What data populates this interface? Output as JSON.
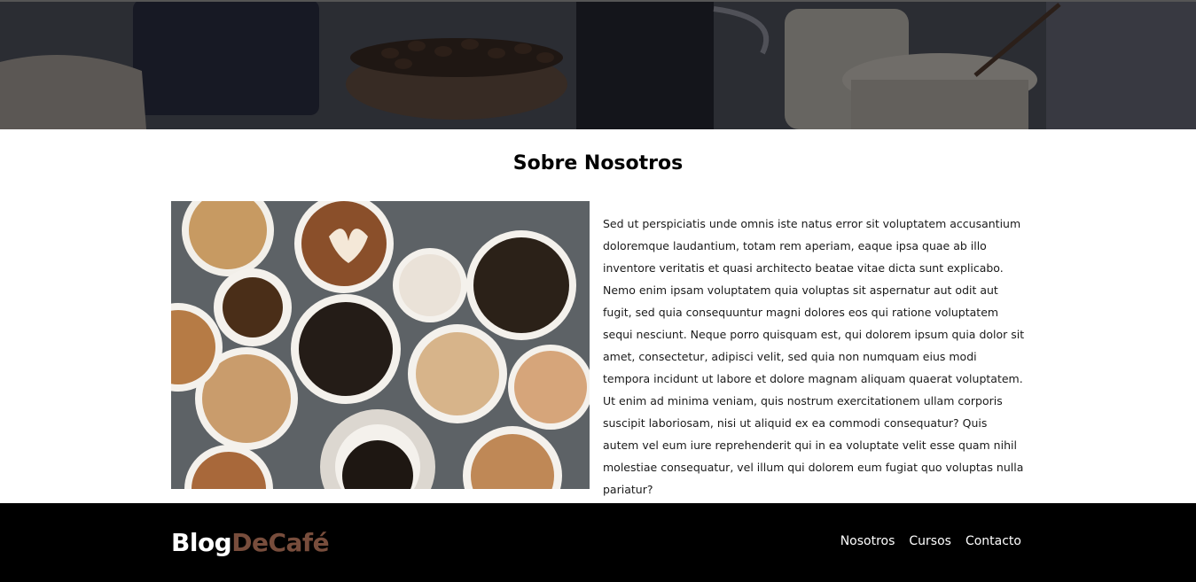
{
  "hero": {
    "image_alt": "coffee-table-hero"
  },
  "about": {
    "title": "Sobre Nosotros",
    "image_alt": "coffee-cups-top-view",
    "paragraph": "Sed ut perspiciatis unde omnis iste natus error sit voluptatem accusantium doloremque laudantium, totam rem aperiam, eaque ipsa quae ab illo inventore veritatis et quasi architecto beatae vitae dicta sunt explicabo. Nemo enim ipsam voluptatem quia voluptas sit aspernatur aut odit aut fugit, sed quia consequuntur magni dolores eos qui ratione voluptatem sequi nesciunt. Neque porro quisquam est, qui dolorem ipsum quia dolor sit amet, consectetur, adipisci velit, sed quia non numquam eius modi tempora incidunt ut labore et dolore magnam aliquam quaerat voluptatem. Ut enim ad minima veniam, quis nostrum exercitationem ullam corporis suscipit laboriosam, nisi ut aliquid ex ea commodi consequatur? Quis autem vel eum iure reprehenderit qui in ea voluptate velit esse quam nihil molestiae consequatur, vel illum qui dolorem eum fugiat quo voluptas nulla pariatur?"
  },
  "footer": {
    "logo_part1": "Blog",
    "logo_part2": "DeCafé",
    "nav": [
      "Nosotros",
      "Cursos",
      "Contacto"
    ]
  },
  "colors": {
    "footer_bg": "#000000",
    "logo_accent": "#784d3c",
    "text": "#1a1a1a"
  }
}
